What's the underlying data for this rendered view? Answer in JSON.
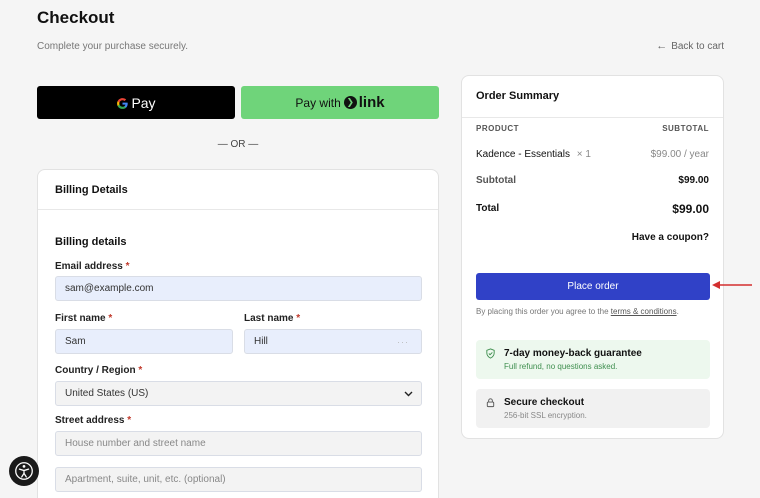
{
  "header": {
    "title": "Checkout",
    "subtitle": "Complete your purchase securely.",
    "back_label": "Back to cart"
  },
  "express": {
    "gpay_text": "Pay",
    "link_prefix": "Pay with",
    "link_brand": "link",
    "or_divider": "— OR —"
  },
  "billing": {
    "card_title": "Billing Details",
    "section_title": "Billing details",
    "email": {
      "label": "Email address",
      "value": "sam@example.com"
    },
    "first_name": {
      "label": "First name",
      "value": "Sam"
    },
    "last_name": {
      "label": "Last name",
      "value": "Hill"
    },
    "country": {
      "label": "Country / Region",
      "value": "United States (US)"
    },
    "street": {
      "label": "Street address",
      "placeholder_1": "House number and street name",
      "placeholder_2": "Apartment, suite, unit, etc. (optional)"
    },
    "required_mark": "*"
  },
  "summary": {
    "title": "Order Summary",
    "col_product": "PRODUCT",
    "col_subtotal": "SUBTOTAL",
    "item_name": "Kadence - Essentials",
    "item_qty": "× 1",
    "item_price": "$99.00 / year",
    "subtotal_label": "Subtotal",
    "subtotal_value": "$99.00",
    "total_label": "Total",
    "total_value": "$99.00",
    "coupon_label": "Have a coupon?",
    "place_order_label": "Place order",
    "terms_prefix": "By placing this order you agree to the",
    "terms_link": "terms & conditions",
    "terms_suffix": "."
  },
  "guarantee": {
    "title": "7-day money-back guarantee",
    "subtitle": "Full refund, no questions asked."
  },
  "secure": {
    "title": "Secure checkout",
    "subtitle": "256-bit SSL encryption."
  },
  "colors": {
    "primary": "#3041c7",
    "link_green": "#6fd47a",
    "annotation_red": "#d32f2f",
    "guarantee_bg": "#edf8ee"
  }
}
